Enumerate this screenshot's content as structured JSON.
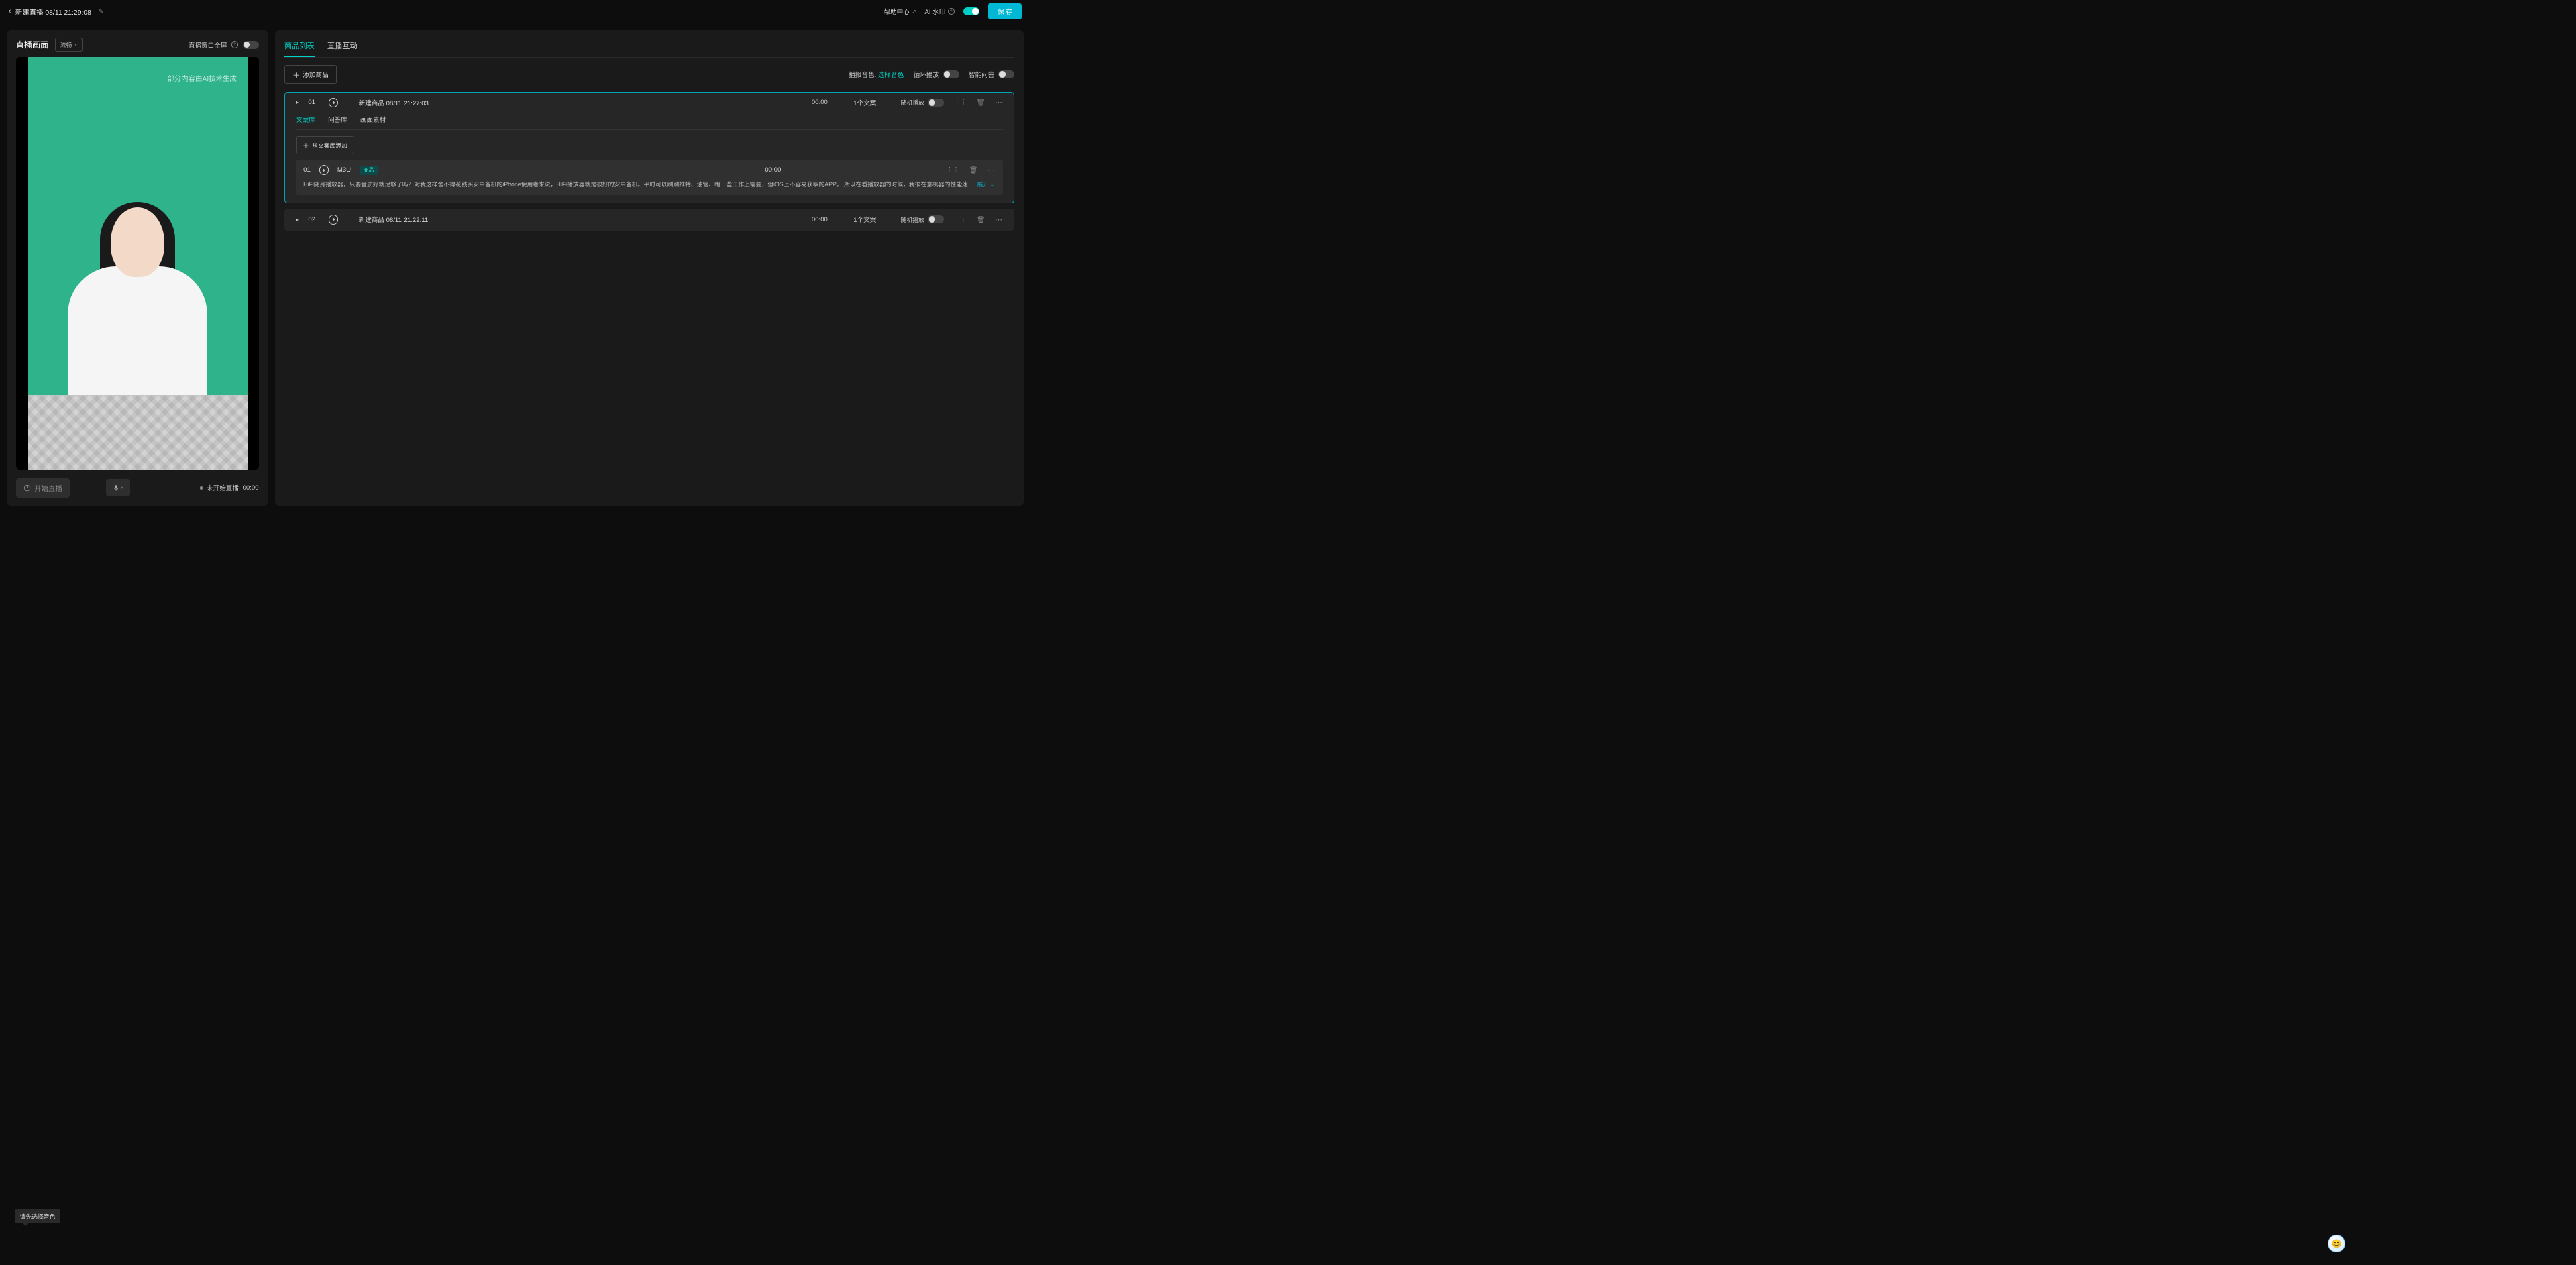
{
  "header": {
    "title": "新建直播 08/11 21:29:08",
    "help_label": "帮助中心",
    "watermark_label": "AI 水印",
    "save_label": "保 存"
  },
  "left": {
    "panel_title": "直播画面",
    "quality": "流畅",
    "fullscreen_label": "直播窗口全屏",
    "preview_watermark": "部分内容由AI技术生成",
    "tooltip": "请先选择音色",
    "start_label": "开始直播",
    "status_label": "未开始直播",
    "status_time": "00:00"
  },
  "tabs": {
    "t1": "商品列表",
    "t2": "直播互动"
  },
  "toolbar": {
    "add_label": "添加商品",
    "voice_label": "播报音色:",
    "voice_value": "选择音色",
    "loop_label": "循环播放",
    "qa_label": "智能问答"
  },
  "products": [
    {
      "index": "01",
      "name": "新建商品 08/11 21:27:03",
      "duration": "00:00",
      "count": "1个文案",
      "random_label": "随机播放",
      "subtabs": {
        "a": "文案库",
        "b": "问答库",
        "c": "画面素材"
      },
      "sub_add": "从文案库添加",
      "script": {
        "index": "01",
        "name": "M3U",
        "tag": "商品",
        "time": "00:00",
        "text": "HiFi随身播放器，只要音质好就足够了吗？对我这样舍不得花钱买安卓备机的iPhone使用者来说，HiFi播放器就是很好的安卓备机。平时可以刷刷推特、油管、跑一些工作上需要，但iOS上不容易获取的APP。 所以在看播放器的时候，我很在意机器的性能速度。但...",
        "expand": "展开"
      }
    },
    {
      "index": "02",
      "name": "新建商品 08/11 21:22:11",
      "duration": "00:00",
      "count": "1个文案",
      "random_label": "随机播放"
    }
  ]
}
